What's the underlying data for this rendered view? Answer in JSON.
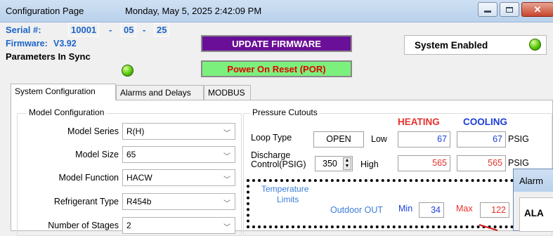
{
  "window": {
    "title": "Configuration Page",
    "datetime": "Monday, May 5, 2025 2:42:09 PM"
  },
  "header": {
    "serial_label": "Serial #:",
    "serial_part1": "10001",
    "serial_sep1": "-",
    "serial_part2": "05",
    "serial_sep2": "-",
    "serial_part3": "25",
    "firmware_label": "Firmware:",
    "firmware_version": "V3.92",
    "params_label": "Parameters In Sync",
    "update_button": "UPDATE FIRMWARE",
    "por_button": "Power On Reset (POR)",
    "system_status": "System Enabled"
  },
  "tabs": [
    {
      "label": "System Configuration",
      "active": true
    },
    {
      "label": "Alarms and Delays",
      "active": false
    },
    {
      "label": "MODBUS",
      "active": false
    }
  ],
  "model_config": {
    "title": "Model Configuration",
    "fields": [
      {
        "label": "Model Series",
        "value": "R(H)"
      },
      {
        "label": "Model Size",
        "value": "65"
      },
      {
        "label": "Model Function",
        "value": "HACW"
      },
      {
        "label": "Refrigerant Type",
        "value": "R454b"
      },
      {
        "label": "Number of Stages",
        "value": "2"
      }
    ]
  },
  "pressure": {
    "title": "Pressure Cutouts",
    "heating_header": "HEATING",
    "cooling_header": "COOLING",
    "loop_type_label": "Loop Type",
    "loop_type_value": "OPEN",
    "low_label": "Low",
    "low_heating": "67",
    "low_cooling": "67",
    "psig1": "PSIG",
    "discharge_label_1": "Discharge",
    "discharge_label_2": "Control(PSIG)",
    "discharge_value": "350",
    "high_label": "High",
    "high_heating": "565",
    "high_cooling": "565",
    "psig2": "PSIG"
  },
  "temperature": {
    "title_1": "Temperature",
    "title_2": "Limits",
    "outdoor_label": "Outdoor OUT",
    "min_label": "Min",
    "min_value": "34",
    "max_label": "Max",
    "max_value": "122"
  },
  "popup": {
    "title": "Alarm",
    "body": "ALA"
  },
  "colors": {
    "accent_blue": "#1c64c8",
    "heating_red": "#e6322d",
    "cooling_blue": "#1c3fd8",
    "update_bg": "#6a0f98",
    "por_bg": "#7cf07c",
    "led_green": "#59c80a"
  }
}
